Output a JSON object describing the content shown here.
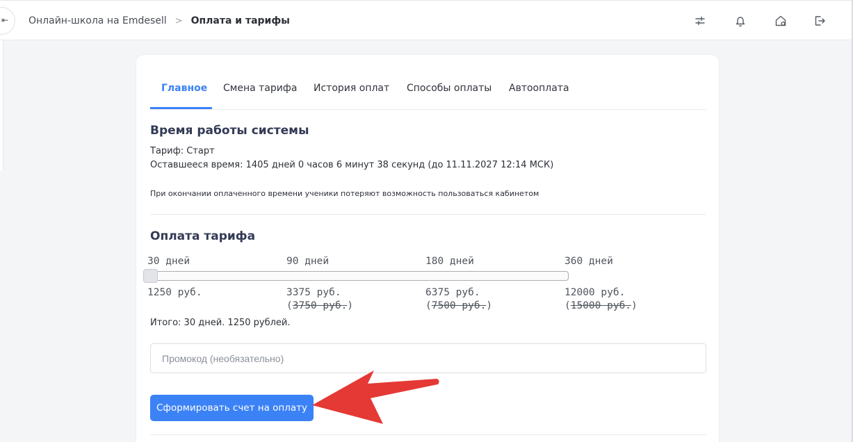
{
  "header": {
    "collapse_glyph": "⇤",
    "breadcrumb_parent": "Онлайн-школа на Emdesell",
    "breadcrumb_separator": ">",
    "breadcrumb_current": "Оплата и тарифы",
    "icons": [
      "sliders-icon",
      "bell-icon",
      "home-settings-icon",
      "logout-icon"
    ]
  },
  "tabs": [
    {
      "label": "Главное",
      "active": true
    },
    {
      "label": "Смена тарифа",
      "active": false
    },
    {
      "label": "История оплат",
      "active": false
    },
    {
      "label": "Способы оплаты",
      "active": false
    },
    {
      "label": "Автооплата",
      "active": false
    }
  ],
  "system": {
    "title": "Время работы системы",
    "tariff": "Тариф: Старт",
    "remaining": "Оставшееся время: 1405 дней 0 часов 6 минут 38 секунд (до 11.11.2027 12:14 МСК)",
    "note": "При окончании оплаченного времени ученики потеряют возможность пользоваться кабинетом"
  },
  "payment": {
    "title": "Оплата тарифа",
    "slider_selected_index": 0,
    "plans": [
      {
        "label": "30 дней",
        "price": "1250 руб.",
        "old_price": ""
      },
      {
        "label": "90 дней",
        "price": "3375 руб.",
        "old_price": "3750 руб."
      },
      {
        "label": "180 дней",
        "price": "6375 руб.",
        "old_price": "7500 руб."
      },
      {
        "label": "360 дней",
        "price": "12000 руб.",
        "old_price": "15000 руб."
      }
    ],
    "total": "Итого: 30 дней. 1250 рублей.",
    "promo_placeholder": "Промокод (необязательно)",
    "submit_label": "Сформировать счет на оплату"
  },
  "colors": {
    "accent": "#3b82f6",
    "arrow": "#e53935"
  }
}
